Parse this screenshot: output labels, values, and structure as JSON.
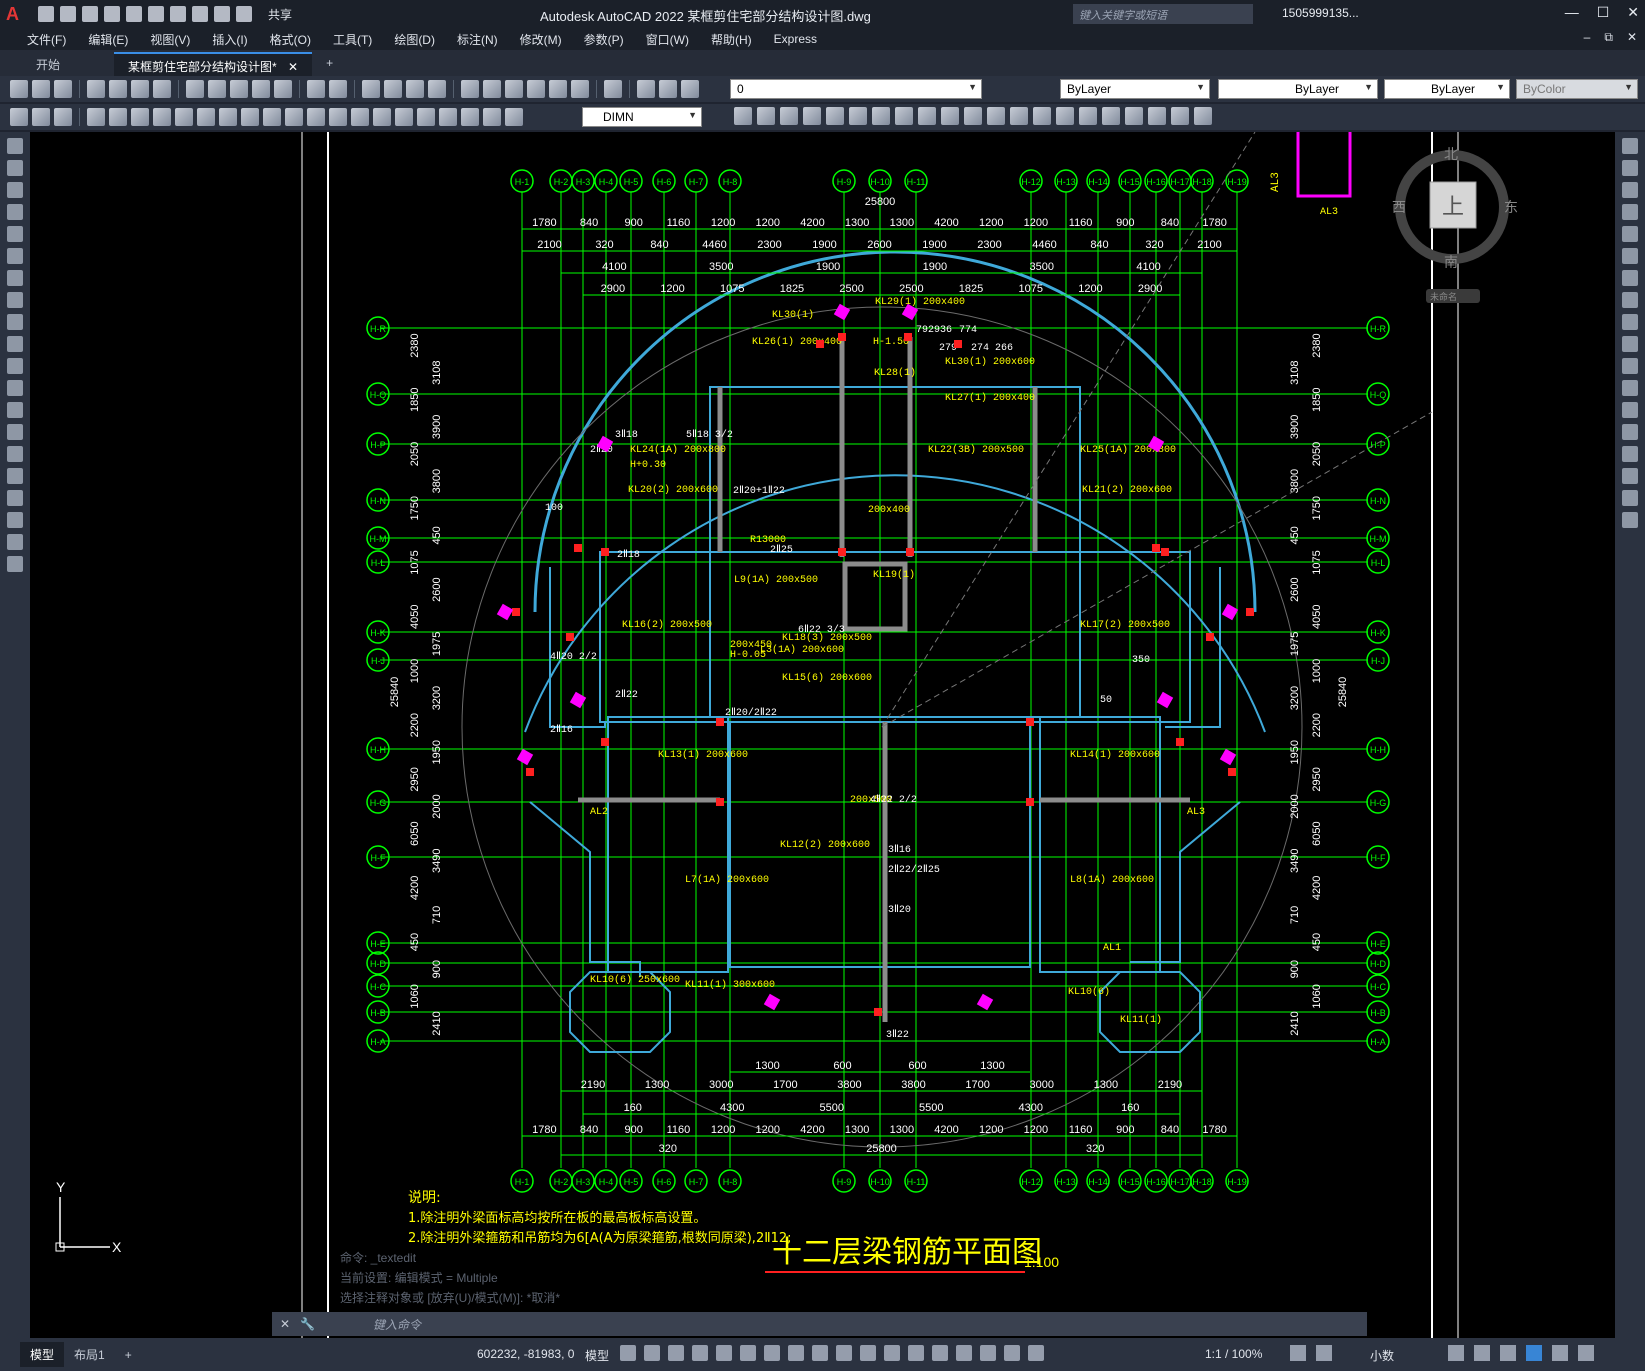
{
  "app": {
    "logo": "A",
    "window_title": "Autodesk AutoCAD 2022    某框剪住宅部分结构设计图.dwg",
    "search_placeholder": "键入关键字或短语",
    "user": "1505999135...",
    "share_label": "共享"
  },
  "menu": [
    "文件(F)",
    "编辑(E)",
    "视图(V)",
    "插入(I)",
    "格式(O)",
    "工具(T)",
    "绘图(D)",
    "标注(N)",
    "修改(M)",
    "参数(P)",
    "窗口(W)",
    "帮助(H)",
    "Express"
  ],
  "tabs": [
    {
      "label": "开始"
    },
    {
      "label": "某框剪住宅部分结构设计图*"
    }
  ],
  "toolbar": {
    "layer": "0",
    "dimstyle": "DIMN",
    "color": "ByLayer",
    "linetype": "ByLayer",
    "lineweight": "ByLayer",
    "plotstyle": "ByColor"
  },
  "viewcube": {
    "north": "北",
    "south": "南",
    "east": "东",
    "west": "西",
    "top": "上",
    "wcs": "未命名"
  },
  "drawing": {
    "title": "十二层梁钢筋平面图",
    "scale": "1:100",
    "notes_title": "说明:",
    "notes": [
      "1.除注明外梁面标高均按所在板的最高板标高设置。",
      "2.除注明外梁箍筋和吊筋均为6[A(A为原梁箍筋,根数同原梁),2Ⅱ12;"
    ],
    "top_axes": [
      "H-1",
      "H-2",
      "H-3",
      "H-4",
      "H-5",
      "H-6",
      "H-7",
      "H-8",
      "H-9",
      "H-10",
      "H-11",
      "H-12",
      "H-13",
      "H-14",
      "H-15",
      "H-16",
      "H-17",
      "H-18",
      "H-19"
    ],
    "left_axes": [
      "H-R",
      "H-Q",
      "H-P",
      "H-N",
      "H-M",
      "H-L",
      "H-K",
      "H-J",
      "H-H",
      "H-G",
      "H-F",
      "H-E",
      "H-D",
      "H-C",
      "H-B",
      "H-A"
    ],
    "total_dim": "25800",
    "left_total": "25840",
    "top_dims_row1": [
      "1780",
      "840",
      "900",
      "1160",
      "1200",
      "1200",
      "4200",
      "1300",
      "1300",
      "4200",
      "1200",
      "1200",
      "1160",
      "900",
      "840",
      "1780"
    ],
    "top_dims_row2": [
      "2100",
      "320",
      "840",
      "4460",
      "2300",
      "1900",
      "2600",
      "1900",
      "2300",
      "4460",
      "840",
      "320",
      "2100"
    ],
    "top_dims_row3": [
      "4100",
      "3500",
      "1900",
      "1900",
      "3500",
      "4100"
    ],
    "top_dims_row4": [
      "2900",
      "1200",
      "1075",
      "1825",
      "2500",
      "2500",
      "1825",
      "1075",
      "1200",
      "2900"
    ],
    "bottom_dims_row1": [
      "1300",
      "600",
      "600",
      "1300"
    ],
    "bottom_dims_row2": [
      "2190",
      "1300",
      "3000",
      "1700",
      "3800",
      "3800",
      "1700",
      "3000",
      "1300",
      "2190"
    ],
    "bottom_dims_row3": [
      "160",
      "4300",
      "5500",
      "5500",
      "4300",
      "160"
    ],
    "bottom_dims_row4": [
      "1780",
      "840",
      "900",
      "1160",
      "1200",
      "1200",
      "4200",
      "1300",
      "1300",
      "4200",
      "1200",
      "1200",
      "1160",
      "900",
      "840",
      "1780"
    ],
    "bottom_dims_row5": [
      "320",
      "25800",
      "320"
    ],
    "left_dims": [
      "2380",
      "3108",
      "1850",
      "3900",
      "2050",
      "3800",
      "1750",
      "450",
      "1075",
      "2600",
      "4050",
      "1975",
      "1000",
      "3200",
      "2200",
      "1950",
      "2950",
      "2000",
      "6050",
      "3490",
      "4200",
      "710",
      "450",
      "900",
      "1060",
      "2410"
    ],
    "beam_labels": [
      "KL30(1)",
      "KL29(1) 200x400",
      "KL26(1) 200x400",
      "KL30(1) 200x600",
      "KL28(1)",
      "KL27(1) 200x400",
      "KL24(1A) 200x800",
      "KL25(1A) 200x800",
      "KL20(2) 200x600",
      "KL21(2) 200x600",
      "KL22(3B) 200x500",
      "KL19(1)",
      "KL18(3) 200x500",
      "KL16(2) 200x500",
      "KL17(2) 200x500",
      "KL15(6) 200x600",
      "KL13(1) 200x600",
      "KL14(1) 200x600",
      "KL12(2) 200x600",
      "KL10(6) 250x600",
      "KL11(1) 300x600",
      "KL10(6)",
      "KL11(1)",
      "L9(1A) 200x500",
      "L3(1A) 200x600",
      "L7(1A) 200x600",
      "L8(1A) 200x600",
      "AL1",
      "AL2",
      "AL3",
      "R13000",
      "H-1.50",
      "200x400",
      "200x450",
      "200x500",
      "H-0.05",
      "H+0.30"
    ],
    "rebar_labels": [
      "3Ⅱ18",
      "2Ⅱ20",
      "5Ⅱ18 3/2",
      "2Ⅱ18",
      "2Ⅱ20+1Ⅱ22",
      "6Ⅱ22 3/3",
      "2Ⅱ22",
      "4Ⅱ20 2/2",
      "2Ⅱ20/2Ⅱ22",
      "2Ⅱ16",
      "3Ⅱ20",
      "3Ⅱ22",
      "2Ⅱ25",
      "4Ⅱ22 2/2",
      "2Ⅱ22/2Ⅱ25",
      "3Ⅱ16",
      "792",
      "774",
      "936",
      "279",
      "274",
      "266",
      "100",
      "50",
      "350"
    ]
  },
  "command": {
    "history": [
      "命令: _textedit",
      "当前设置: 编辑模式 = Multiple",
      "选择注释对象或 [放弃(U)/模式(M)]: *取消*"
    ],
    "placeholder": "键入命令"
  },
  "status": {
    "tabs": [
      "模型",
      "布局1"
    ],
    "coords": "602232, -81983, 0",
    "model_label": "模型",
    "scale": "1:1 / 100%",
    "units": "小数"
  },
  "ucs": {
    "y": "Y",
    "x": "X"
  }
}
